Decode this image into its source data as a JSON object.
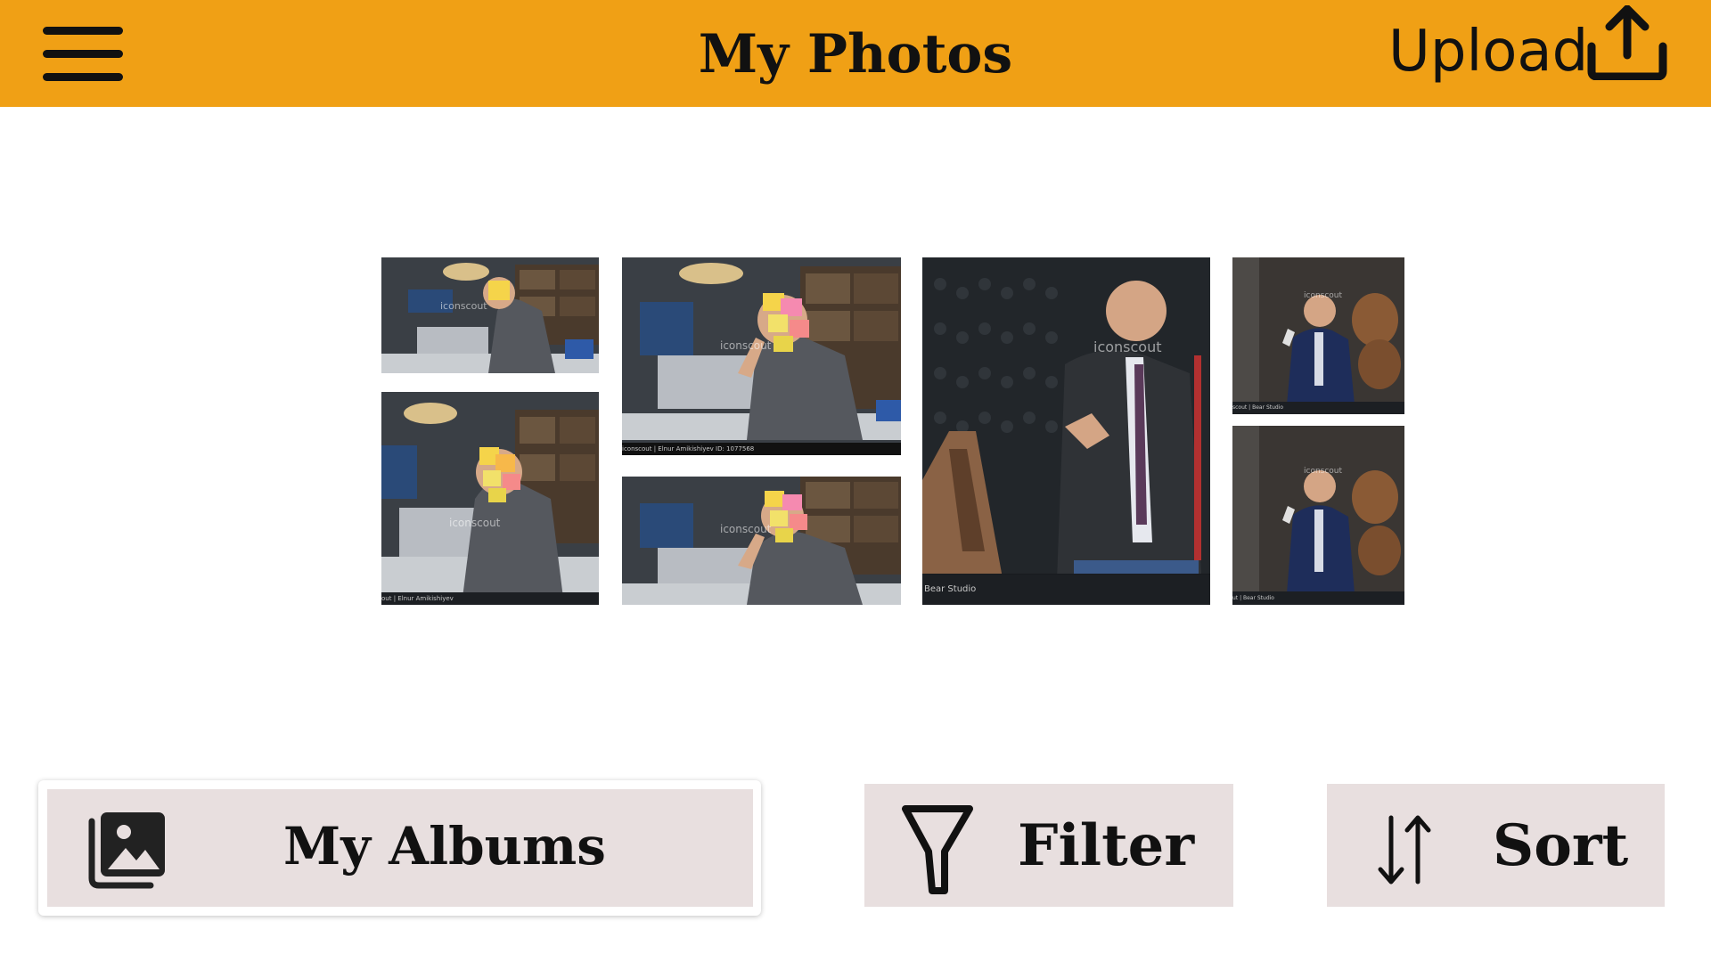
{
  "header": {
    "menu_icon": "hamburger-menu-icon",
    "title": "My Photos",
    "upload_label": "Upload",
    "upload_icon": "upload-icon",
    "background_color": "#f0a015"
  },
  "photos": [
    {
      "alt": "Businessman with sticky note on face at desk at night",
      "watermark": "iconscout",
      "sub": "Elnur Amikishiyev",
      "caption": ""
    },
    {
      "alt": "Businessman covered in sticky notes at desk at night",
      "watermark": "iconscout",
      "sub": "Elnur Amikishiyev",
      "caption": "out | Elnur Amikishiyev"
    },
    {
      "alt": "Businessman covered in sticky notes gesturing at desk",
      "watermark": "iconscout",
      "sub": "Elnur Amikishiyev",
      "caption": "iconscout | Elnur Amikishiyev  ID: 1077568"
    },
    {
      "alt": "Businessman covered in sticky notes gesturing at desk",
      "watermark": "iconscout",
      "sub": "Elnur Amikishiyev",
      "caption": ""
    },
    {
      "alt": "Man in jacket standing in wine cellar",
      "watermark": "iconscout",
      "sub": "Bear Studio",
      "caption": "Bear Studio"
    },
    {
      "alt": "Man holding wine glass in cellar",
      "watermark": "iconscout",
      "sub": "Bear Studio",
      "caption": "scout | Bear Studio"
    },
    {
      "alt": "Man holding wine glass in cellar",
      "watermark": "iconscout",
      "sub": "Bear Studio",
      "caption": "ut | Bear Studio"
    }
  ],
  "actions": {
    "albums_label": "My Albums",
    "albums_icon": "photo-gallery-icon",
    "filter_label": "Filter",
    "filter_icon": "funnel-icon",
    "sort_label": "Sort",
    "sort_icon": "sort-arrows-icon",
    "button_color": "#e8dfdf"
  }
}
